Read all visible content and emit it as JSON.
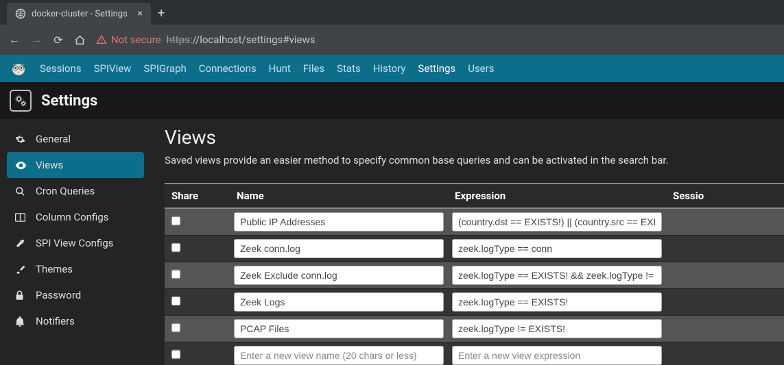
{
  "browser": {
    "tab_title": "docker-cluster - Settings",
    "not_secure": "Not secure",
    "url_https": "https",
    "url_rest": "://localhost/settings#views"
  },
  "nav": {
    "items": [
      "Sessions",
      "SPIView",
      "SPIGraph",
      "Connections",
      "Hunt",
      "Files",
      "Stats",
      "History",
      "Settings",
      "Users"
    ],
    "active": "Settings"
  },
  "page_title": "Settings",
  "sidebar": {
    "items": [
      {
        "label": "General",
        "icon": "gear-icon"
      },
      {
        "label": "Views",
        "icon": "eye-icon"
      },
      {
        "label": "Cron Queries",
        "icon": "search-icon"
      },
      {
        "label": "Column Configs",
        "icon": "columns-icon"
      },
      {
        "label": "SPI View Configs",
        "icon": "eyedropper-icon"
      },
      {
        "label": "Themes",
        "icon": "brush-icon"
      },
      {
        "label": "Password",
        "icon": "lock-icon"
      },
      {
        "label": "Notifiers",
        "icon": "bell-icon"
      }
    ],
    "active_index": 1
  },
  "main": {
    "heading": "Views",
    "description": "Saved views provide an easier method to specify common base queries and can be activated in the search bar."
  },
  "table": {
    "headers": {
      "share": "Share",
      "name": "Name",
      "expr": "Expression",
      "sess": "Sessio"
    },
    "rows": [
      {
        "share": false,
        "name": "Public IP Addresses",
        "expr": "(country.dst == EXISTS!) || (country.src == EXIS"
      },
      {
        "share": false,
        "name": "Zeek conn.log",
        "expr": "zeek.logType == conn"
      },
      {
        "share": false,
        "name": "Zeek Exclude conn.log",
        "expr": "zeek.logType == EXISTS! && zeek.logType !="
      },
      {
        "share": false,
        "name": "Zeek Logs",
        "expr": "zeek.logType == EXISTS!"
      },
      {
        "share": false,
        "name": "PCAP Files",
        "expr": "zeek.logType != EXISTS!"
      }
    ],
    "new_row": {
      "name_placeholder": "Enter a new view name (20 chars or less)",
      "expr_placeholder": "Enter a new view expression"
    }
  }
}
